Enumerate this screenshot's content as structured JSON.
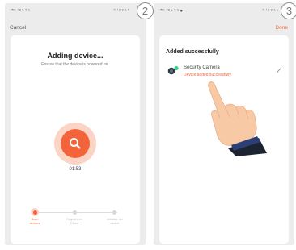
{
  "steps": {
    "left": "2",
    "right": "3"
  },
  "left_screen": {
    "status_left": "ᵀᵐ ⁴ᴳ ᴸ ⁰ ⁵",
    "status_right": "⁰ ⁴⁸ ⁹ ¹ ⁵",
    "nav_left": "Cancel",
    "title": "Adding device...",
    "subtitle": "Ensure that the device is powered on.",
    "timer": "01:53",
    "icon": "search-icon",
    "progress": {
      "steps": [
        {
          "label_line1": "Scan",
          "label_line2": "devices",
          "state": "active"
        },
        {
          "label_line1": "Register on",
          "label_line2": "Cloud",
          "state": "inactive"
        },
        {
          "label_line1": "Initialize the",
          "label_line2": "device",
          "state": "inactive"
        }
      ]
    }
  },
  "right_screen": {
    "status_left": "ᵀᵐ ⁴ᴳ ᴸ ⁰ ⁵ ●",
    "status_right": "⁰ ⁴⁸ ⁹ ¹ ⁵",
    "nav_right": "Done",
    "added_title": "Added successfully",
    "device_name": "Security Camera",
    "device_status": "Device added successfully",
    "device_icon": "camera-icon",
    "edit_icon": "pencil-icon",
    "illustration": "pointing-hand-icon"
  },
  "colors": {
    "accent": "#f4643a",
    "accent_light": "#fcd4c5",
    "background": "#ececec",
    "card": "#ffffff",
    "done": "#ff6b3d"
  }
}
